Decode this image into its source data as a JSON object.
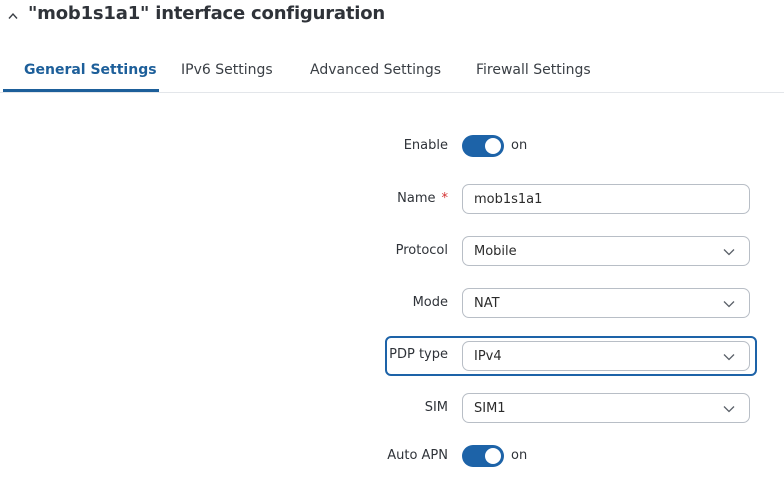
{
  "header": {
    "title": "\"mob1s1a1\" interface configuration"
  },
  "tabs": [
    {
      "label": "General Settings"
    },
    {
      "label": "IPv6 Settings"
    },
    {
      "label": "Advanced Settings"
    },
    {
      "label": "Firewall Settings"
    }
  ],
  "form": {
    "enable": {
      "label": "Enable",
      "state": "on"
    },
    "name": {
      "label": "Name",
      "required_mark": "*",
      "value": "mob1s1a1"
    },
    "protocol": {
      "label": "Protocol",
      "value": "Mobile"
    },
    "mode": {
      "label": "Mode",
      "value": "NAT"
    },
    "pdp_type": {
      "label": "PDP type",
      "value": "IPv4"
    },
    "sim": {
      "label": "SIM",
      "value": "SIM1"
    },
    "auto_apn": {
      "label": "Auto APN",
      "state": "on"
    }
  },
  "colors": {
    "accent": "#1d63a8",
    "active_tab": "#1d5f9a",
    "required": "#d32f2f"
  }
}
